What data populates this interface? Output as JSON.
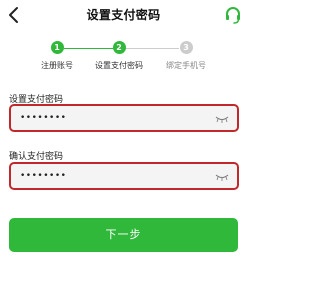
{
  "header": {
    "title": "设置支付密码",
    "back_icon": "chevron-left-icon",
    "service_icon": "headset-icon"
  },
  "steps": [
    {
      "number": "1",
      "label": "注册账号",
      "state": "done"
    },
    {
      "number": "2",
      "label": "设置支付密码",
      "state": "current"
    },
    {
      "number": "3",
      "label": "绑定手机号",
      "state": "pending"
    }
  ],
  "form": {
    "password_label": "设置支付密码",
    "password_value": "••••••••",
    "confirm_label": "确认支付密码",
    "confirm_value": "••••••••",
    "eye_icon": "eye-closed-icon"
  },
  "actions": {
    "next_label": "下一步"
  },
  "colors": {
    "accent": "#2fb83a",
    "inactive": "#cccccc",
    "error_border": "#c0282c"
  }
}
